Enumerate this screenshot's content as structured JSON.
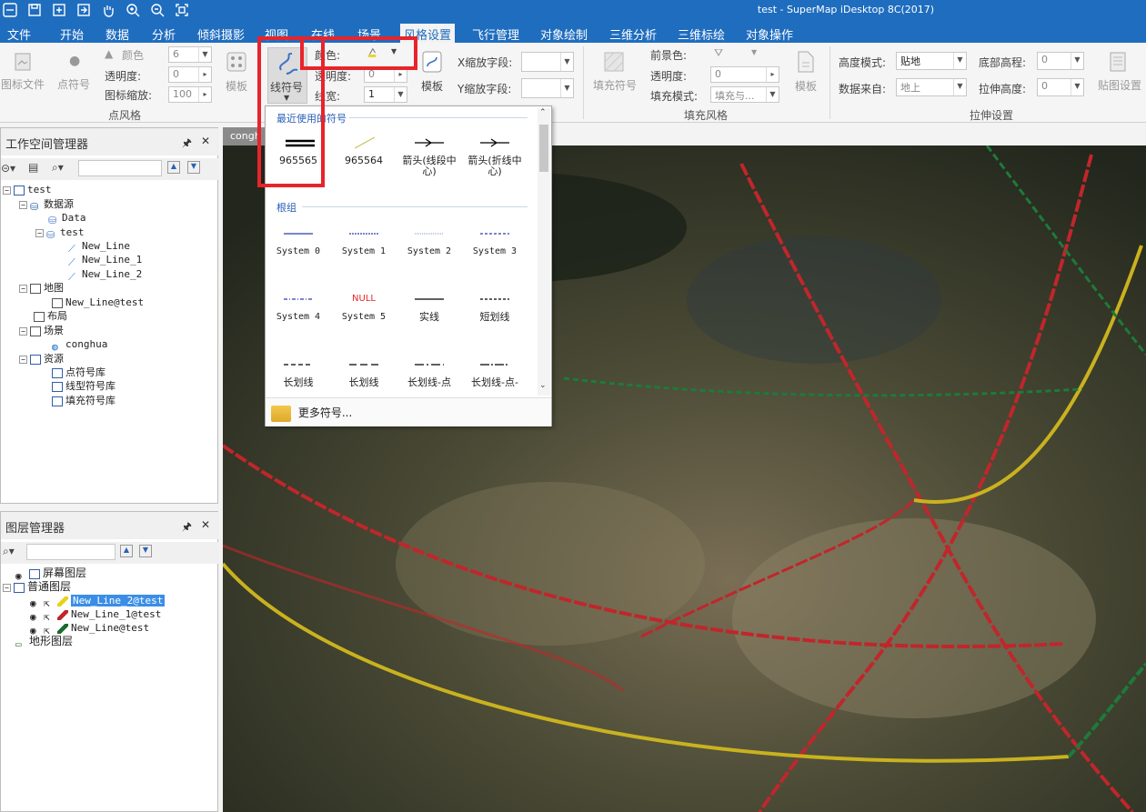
{
  "window_title": "test - SuperMap iDesktop 8C(2017)",
  "menu_tabs": [
    "文件",
    "开始",
    "数据",
    "分析",
    "倾斜摄影",
    "视图",
    "在线",
    "场景",
    "风格设置",
    "飞行管理",
    "对象绘制",
    "三维分析",
    "三维标绘",
    "对象操作"
  ],
  "active_tab": "风格设置",
  "ribbon": {
    "point_style": {
      "group_label": "点风格",
      "icon_file": "图标文件",
      "point_symbol": "点符号",
      "color_label": "颜色",
      "transparency_label": "透明度:",
      "icon_scale_label": "图标缩放:",
      "size_value": "6",
      "transparency_value": "0",
      "scale_value": "100",
      "template": "模板"
    },
    "line_style": {
      "line_symbol": "线符号",
      "color_label": "颜色:",
      "transparency_label": "透明度:",
      "width_label": "线宽:",
      "transparency_value": "0",
      "width_value": "1",
      "template": "模板",
      "x_scale_label": "X缩放字段:",
      "y_scale_label": "Y缩放字段:"
    },
    "fill_style": {
      "group_label": "填充风格",
      "fill_symbol": "填充符号",
      "fg_color_label": "前景色:",
      "transparency_label": "透明度:",
      "fill_mode_label": "填充模式:",
      "transparency_value": "0",
      "fill_mode_value": "填充与...",
      "template": "模板"
    },
    "extrude": {
      "group_label": "拉伸设置",
      "height_mode_label": "高度模式:",
      "height_mode_value": "贴地",
      "data_from_label": "数据来自:",
      "data_from_value": "地上",
      "bottom_alt_label": "底部高程:",
      "bottom_alt_value": "0",
      "extrude_height_label": "拉伸高度:",
      "extrude_height_value": "0",
      "texture": "贴图设置"
    }
  },
  "workspace_panel": {
    "title": "工作空间管理器",
    "tree": [
      {
        "label": "test",
        "depth": 0,
        "icon": "workspace-icon"
      },
      {
        "label": "数据源",
        "depth": 1,
        "icon": "datasources-icon"
      },
      {
        "label": "Data",
        "depth": 2,
        "icon": "database-icon"
      },
      {
        "label": "test",
        "depth": 2,
        "icon": "database-icon"
      },
      {
        "label": "New_Line",
        "depth": 3,
        "icon": "line-dataset-icon"
      },
      {
        "label": "New_Line_1",
        "depth": 3,
        "icon": "line-dataset-icon"
      },
      {
        "label": "New_Line_2",
        "depth": 3,
        "icon": "line-dataset-icon"
      },
      {
        "label": "地图",
        "depth": 1,
        "icon": "maps-icon"
      },
      {
        "label": "New_Line@test",
        "depth": 2,
        "icon": "map-icon"
      },
      {
        "label": "布局",
        "depth": 1,
        "icon": "layout-icon"
      },
      {
        "label": "场景",
        "depth": 1,
        "icon": "scenes-icon"
      },
      {
        "label": "conghua",
        "depth": 2,
        "icon": "globe-icon"
      },
      {
        "label": "资源",
        "depth": 1,
        "icon": "resources-icon"
      },
      {
        "label": "点符号库",
        "depth": 2,
        "icon": "point-lib-icon"
      },
      {
        "label": "线型符号库",
        "depth": 2,
        "icon": "line-lib-icon"
      },
      {
        "label": "填充符号库",
        "depth": 2,
        "icon": "fill-lib-icon"
      }
    ]
  },
  "layer_panel": {
    "title": "图层管理器",
    "tree": [
      {
        "label": "屏幕图层",
        "depth": 0
      },
      {
        "label": "普通图层",
        "depth": 0
      },
      {
        "label": "New_Line_2@test",
        "depth": 1,
        "color": "#e8d21a",
        "selected": true
      },
      {
        "label": "New_Line_1@test",
        "depth": 1,
        "color": "#c0262b",
        "selected": false
      },
      {
        "label": "New_Line@test",
        "depth": 1,
        "color": "#1e6b2e",
        "selected": false
      },
      {
        "label": "地形图层",
        "depth": 0
      }
    ]
  },
  "map_tab": "congh",
  "symbol_dropdown": {
    "recent_header": "最近使用的符号",
    "root_header": "根组",
    "recent": [
      {
        "label": "965565",
        "kind": "double"
      },
      {
        "label": "965564",
        "kind": "yellow-diag"
      },
      {
        "label": "箭头(线段中\n心)",
        "kind": "arrow"
      },
      {
        "label": "箭头(折线中\n心)",
        "kind": "arrow"
      }
    ],
    "root": [
      {
        "label": "System 0",
        "kind": "blue-solid"
      },
      {
        "label": "System 1",
        "kind": "blue-dash"
      },
      {
        "label": "System 2",
        "kind": "blue-light"
      },
      {
        "label": "System 3",
        "kind": "blue-dash2"
      },
      {
        "label": "System 4",
        "kind": "blue-dashdot"
      },
      {
        "label": "System 5",
        "kind": "null"
      },
      {
        "label": "实线",
        "kind": "black-solid"
      },
      {
        "label": "短划线",
        "kind": "black-dash"
      },
      {
        "label": "长划线",
        "kind": "long-dash"
      },
      {
        "label": "长划线",
        "kind": "long-dash2"
      },
      {
        "label": "长划线-点",
        "kind": "dash-dot"
      },
      {
        "label": "长划线-点-",
        "kind": "dash-dot2"
      }
    ],
    "null_text": "NULL",
    "more": "更多符号..."
  },
  "colors": {
    "title_bar": "#1f6dbf",
    "highlight": "#e8242b",
    "selection": "#3a8ee6"
  }
}
